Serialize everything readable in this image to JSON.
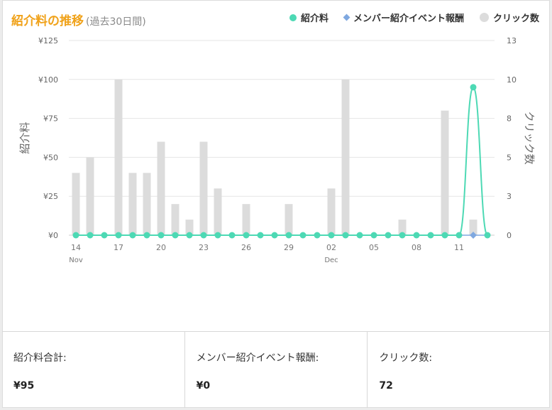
{
  "header": {
    "title": "紹介料の推移",
    "subtitle": "(過去30日間)"
  },
  "legend": [
    {
      "label": "紹介料",
      "color": "#4dd9b4",
      "icon": "circle"
    },
    {
      "label": "メンバー紹介イベント報酬",
      "color": "#7fa8e0",
      "icon": "diamond"
    },
    {
      "label": "クリック数",
      "color": "#dcdcdc",
      "icon": "circle"
    }
  ],
  "chart_data": {
    "type": "bar+line",
    "x": [
      "Nov 14",
      "Nov 15",
      "Nov 16",
      "Nov 17",
      "Nov 18",
      "Nov 19",
      "Nov 20",
      "Nov 21",
      "Nov 22",
      "Nov 23",
      "Nov 24",
      "Nov 25",
      "Nov 26",
      "Nov 27",
      "Nov 28",
      "Nov 29",
      "Nov 30",
      "Dec 01",
      "Dec 02",
      "Dec 03",
      "Dec 04",
      "Dec 05",
      "Dec 06",
      "Dec 07",
      "Dec 08",
      "Dec 09",
      "Dec 10",
      "Dec 11",
      "Dec 12",
      "Dec 13"
    ],
    "x_tick_labels": [
      {
        "index": 0,
        "label": "14",
        "sub": "Nov"
      },
      {
        "index": 3,
        "label": "17",
        "sub": ""
      },
      {
        "index": 6,
        "label": "20",
        "sub": ""
      },
      {
        "index": 9,
        "label": "23",
        "sub": ""
      },
      {
        "index": 12,
        "label": "26",
        "sub": ""
      },
      {
        "index": 15,
        "label": "29",
        "sub": ""
      },
      {
        "index": 18,
        "label": "02",
        "sub": "Dec"
      },
      {
        "index": 21,
        "label": "05",
        "sub": ""
      },
      {
        "index": 24,
        "label": "08",
        "sub": ""
      },
      {
        "index": 27,
        "label": "11",
        "sub": ""
      }
    ],
    "series": [
      {
        "name": "クリック数",
        "type": "bar",
        "axis": "right",
        "color": "#dcdcdc",
        "values": [
          4,
          5,
          0,
          10,
          4,
          4,
          6,
          2,
          1,
          6,
          3,
          0,
          2,
          0,
          0,
          2,
          0,
          0,
          3,
          10,
          0,
          0,
          0,
          1,
          0,
          0,
          8,
          0,
          1,
          0
        ]
      },
      {
        "name": "紹介料",
        "type": "line",
        "axis": "left",
        "color": "#4dd9b4",
        "values": [
          0,
          0,
          0,
          0,
          0,
          0,
          0,
          0,
          0,
          0,
          0,
          0,
          0,
          0,
          0,
          0,
          0,
          0,
          0,
          0,
          0,
          0,
          0,
          0,
          0,
          0,
          0,
          0,
          95,
          0
        ]
      },
      {
        "name": "メンバー紹介イベント報酬",
        "type": "line",
        "axis": "left",
        "color": "#7fa8e0",
        "values": [
          0,
          0,
          0,
          0,
          0,
          0,
          0,
          0,
          0,
          0,
          0,
          0,
          0,
          0,
          0,
          0,
          0,
          0,
          0,
          0,
          0,
          0,
          0,
          0,
          0,
          0,
          0,
          0,
          0,
          0
        ]
      }
    ],
    "y_left": {
      "label": "紹介料",
      "ticks": [
        "¥0",
        "¥25",
        "¥50",
        "¥75",
        "¥100",
        "¥125"
      ],
      "range": [
        0,
        125
      ]
    },
    "y_right": {
      "label": "クリック数",
      "ticks": [
        "0",
        "3",
        "5",
        "8",
        "10",
        "13"
      ],
      "tick_values": [
        0,
        2.5,
        5,
        7.5,
        10,
        12.5
      ],
      "range": [
        0,
        12.5
      ]
    },
    "grid": true,
    "legend_position": "top-right"
  },
  "stats": [
    {
      "label": "紹介料合計:",
      "value": "¥95"
    },
    {
      "label": "メンバー紹介イベント報酬:",
      "value": "¥0"
    },
    {
      "label": "クリック数:",
      "value": "72"
    }
  ]
}
